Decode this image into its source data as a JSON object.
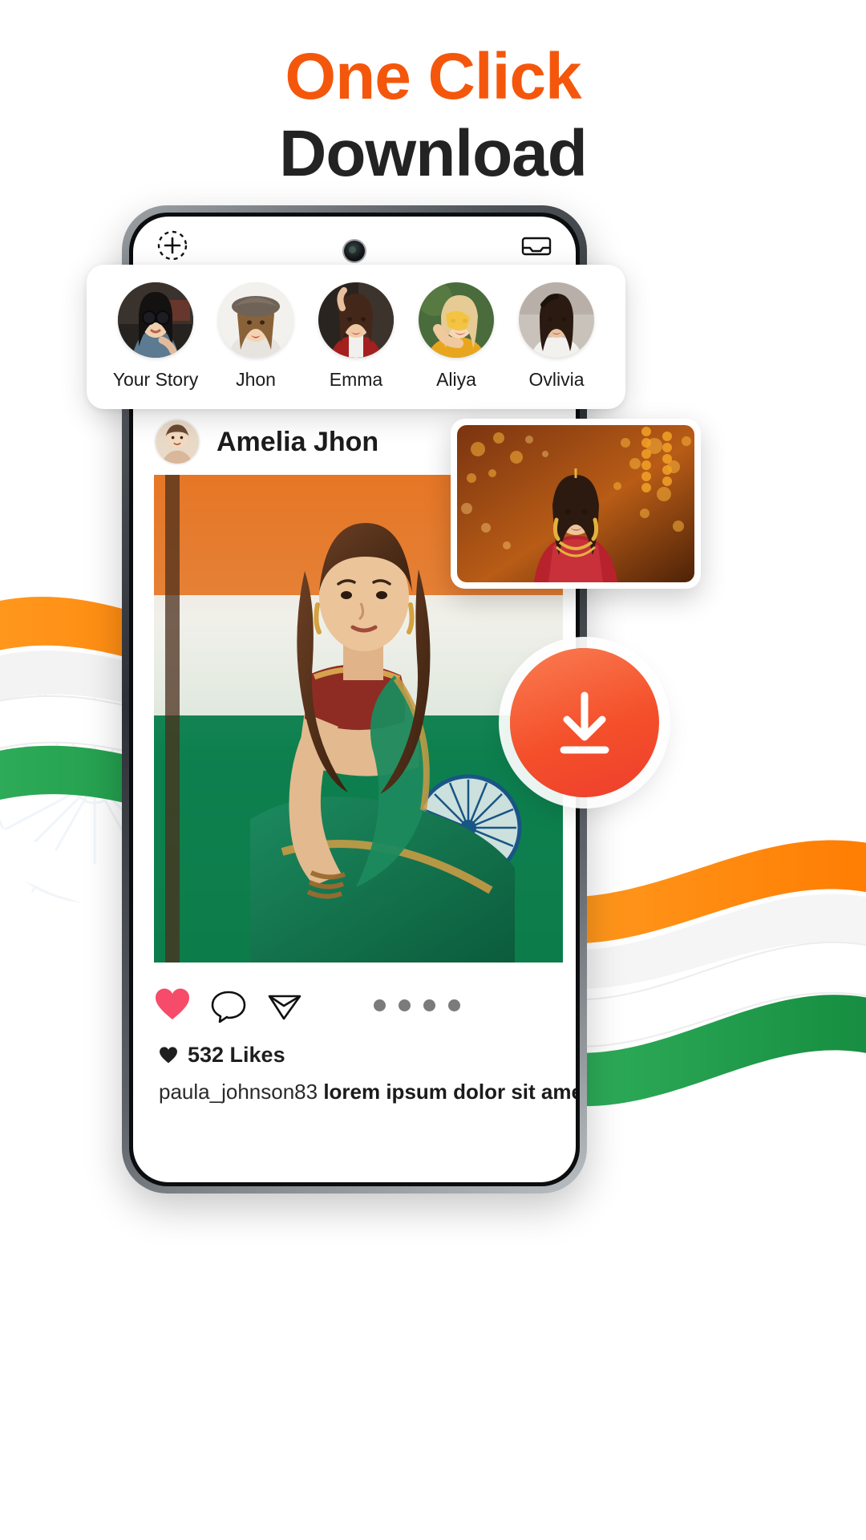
{
  "headline": {
    "line1": "One Click",
    "line2": "Download",
    "accent_color": "#F4570C",
    "dark_color": "#232323"
  },
  "phone": {
    "topbar": {
      "left_icon": "add-story-icon",
      "right_icon": "inbox-icon",
      "camera": "front-camera-dot"
    }
  },
  "stories": {
    "items": [
      {
        "label": "Your Story",
        "avatar": "avatar-sunglasses-woman"
      },
      {
        "label": "Jhon",
        "avatar": "avatar-hat-woman"
      },
      {
        "label": "Emma",
        "avatar": "avatar-red-jacket-woman"
      },
      {
        "label": "Aliya",
        "avatar": "avatar-blonde-yellow-woman"
      },
      {
        "label": "Ovlivia",
        "avatar": "avatar-white-top-woman"
      }
    ]
  },
  "post": {
    "username": "Amelia Jhon",
    "avatar": "avatar-amelia",
    "image_alt": "woman-in-green-saree-with-indian-flag",
    "actions": {
      "like": "heart-icon",
      "comment": "comment-bubble-icon",
      "share": "send-paperplane-icon",
      "pager_dots": 4,
      "like_color": "#F74B6A"
    },
    "likes_text": "532 Likes",
    "likes_count": 532,
    "caption_username": "paula_johnson83",
    "caption_text": "lorem ipsum dolor sit amet"
  },
  "preview": {
    "image_alt": "woman-in-red-lehenga-at-market-stall"
  },
  "download_button": {
    "label": "download-icon",
    "color_start": "#FA7D52",
    "color_end": "#EE3E2C"
  },
  "decor": {
    "saffron": "#FF8A00",
    "white": "#FFFFFF",
    "green": "#1E9E4A",
    "chakra": "#2E6FB7"
  }
}
